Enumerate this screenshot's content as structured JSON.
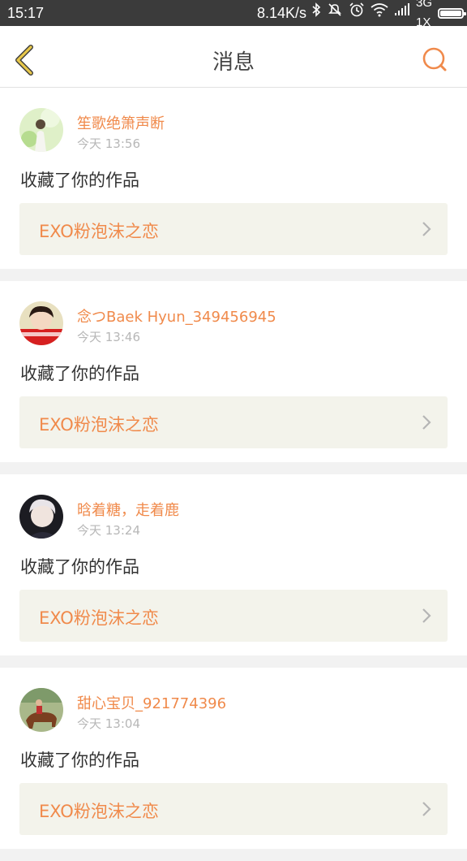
{
  "status_bar": {
    "time": "15:17",
    "network_speed": "8.14K/s",
    "network_type_top": "3G",
    "network_type_bottom": "1X"
  },
  "header": {
    "title": "消息",
    "accent_color": "#f08a4b",
    "back_icon_color": "#e6c54a"
  },
  "notifications": [
    {
      "username": "笙歌绝箫声断",
      "time": "今天 13:56",
      "action": "收藏了你的作品",
      "work_title": "EXO粉泡沫之恋",
      "avatar_icon": "avatar-girl-green"
    },
    {
      "username": "念つBaek Hyun_349456945",
      "time": "今天 13:46",
      "action": "收藏了你的作品",
      "work_title": "EXO粉泡沫之恋",
      "avatar_icon": "avatar-boy-red"
    },
    {
      "username": "晗着糖，走着鹿",
      "time": "今天 13:24",
      "action": "收藏了你的作品",
      "work_title": "EXO粉泡沫之恋",
      "avatar_icon": "avatar-boy-dark"
    },
    {
      "username": "甜心宝贝_921774396",
      "time": "今天 13:04",
      "action": "收藏了你的作品",
      "work_title": "EXO粉泡沫之恋",
      "avatar_icon": "avatar-horse-rider"
    }
  ]
}
